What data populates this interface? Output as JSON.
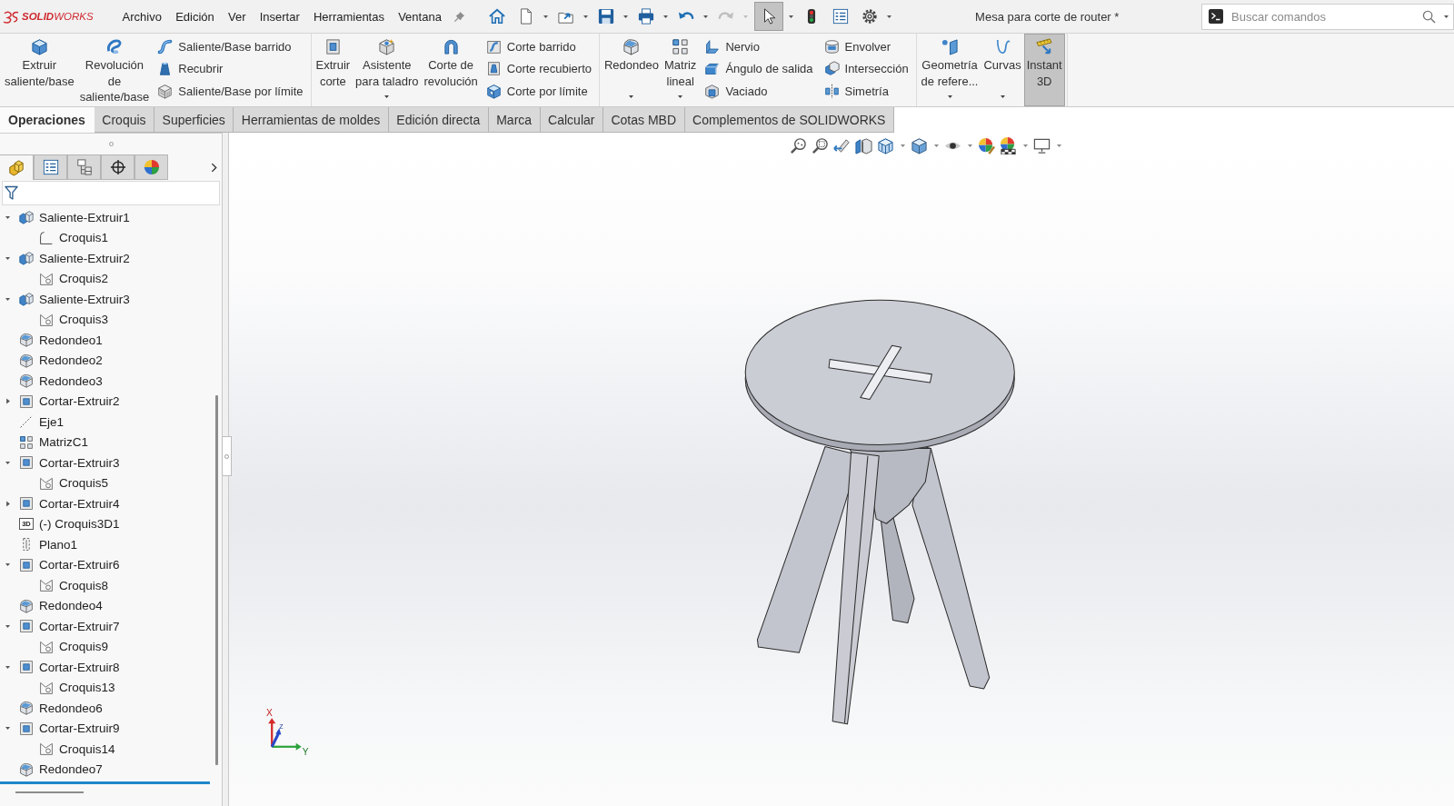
{
  "app_bar": {
    "logo": "**SOLID**WORKS",
    "menu": [
      "Archivo",
      "Edición",
      "Ver",
      "Insertar",
      "Herramientas",
      "Ventana"
    ],
    "tools": [
      {
        "kind": "home",
        "dropdown": false,
        "pressed": false,
        "disabled": false
      },
      {
        "kind": "new",
        "dropdown": true,
        "pressed": false,
        "disabled": false
      },
      {
        "kind": "open",
        "dropdown": true,
        "pressed": false,
        "disabled": false
      },
      {
        "kind": "save",
        "dropdown": true,
        "pressed": false,
        "disabled": false
      },
      {
        "kind": "print",
        "dropdown": true,
        "pressed": false,
        "disabled": false
      },
      {
        "kind": "undo",
        "dropdown": true,
        "pressed": false,
        "disabled": false
      },
      {
        "kind": "redo",
        "dropdown": true,
        "pressed": false,
        "disabled": true
      },
      {
        "kind": "select",
        "dropdown": true,
        "pressed": true,
        "disabled": false
      },
      {
        "kind": "rebuild",
        "dropdown": false,
        "pressed": false,
        "disabled": false
      },
      {
        "kind": "properties",
        "dropdown": false,
        "pressed": false,
        "disabled": false
      },
      {
        "kind": "options",
        "dropdown": true,
        "pressed": false,
        "disabled": false
      }
    ],
    "document_title": "Mesa para corte de router *",
    "search": {
      "placeholder": "Buscar comandos"
    }
  },
  "ribbon": {
    "groups": [
      {
        "buttons": [
          {
            "kind": "extrude",
            "label": "Extruir\nsaliente/base",
            "dropdown": false,
            "pressed": false
          },
          {
            "kind": "revolve",
            "label": "Revolución\nde\nsaliente/base",
            "dropdown": false,
            "pressed": false
          }
        ],
        "stacks": [
          [
            {
              "kind": "sweep",
              "label": "Saliente/Base barrido"
            },
            {
              "kind": "loft",
              "label": "Recubrir"
            },
            {
              "kind": "boundary",
              "label": "Saliente/Base por límite"
            }
          ]
        ]
      },
      {
        "buttons": [
          {
            "kind": "cutextrude",
            "label": "Extruir\ncorte",
            "dropdown": false,
            "pressed": false
          },
          {
            "kind": "hole",
            "label": "Asistente\npara taladro",
            "dropdown": true,
            "pressed": false
          },
          {
            "kind": "cutrevolve",
            "label": "Corte de\nrevolución",
            "dropdown": false,
            "pressed": false
          }
        ],
        "stacks": [
          [
            {
              "kind": "cutsweep",
              "label": "Corte barrido"
            },
            {
              "kind": "cutloft",
              "label": "Corte recubierto"
            },
            {
              "kind": "cutboundary",
              "label": "Corte por límite"
            }
          ]
        ]
      },
      {
        "buttons": [
          {
            "kind": "fillet",
            "label": "Redondeo",
            "dropdown": true,
            "pressed": false
          },
          {
            "kind": "pattern",
            "label": "Matriz\nlineal",
            "dropdown": true,
            "pressed": false
          }
        ],
        "stacks": [
          [
            {
              "kind": "rib",
              "label": "Nervio"
            },
            {
              "kind": "draft",
              "label": "Ángulo de salida"
            },
            {
              "kind": "shell",
              "label": "Vaciado"
            }
          ],
          [
            {
              "kind": "wrap",
              "label": "Envolver"
            },
            {
              "kind": "intersect",
              "label": "Intersección"
            },
            {
              "kind": "mirror",
              "label": "Simetría"
            }
          ]
        ]
      },
      {
        "buttons": [
          {
            "kind": "refgeometry",
            "label": "Geometría\nde refere...",
            "dropdown": true,
            "pressed": false
          },
          {
            "kind": "curves",
            "label": "Curvas",
            "dropdown": true,
            "pressed": false
          },
          {
            "kind": "instant3d",
            "label": "Instant\n3D",
            "dropdown": false,
            "pressed": true
          }
        ]
      }
    ]
  },
  "tabs": [
    {
      "label": "Operaciones",
      "selected": true
    },
    {
      "label": "Croquis",
      "selected": false
    },
    {
      "label": "Superficies",
      "selected": false
    },
    {
      "label": "Herramientas de moldes",
      "selected": false
    },
    {
      "label": "Edición directa",
      "selected": false
    },
    {
      "label": "Marca",
      "selected": false
    },
    {
      "label": "Calcular",
      "selected": false
    },
    {
      "label": "Cotas MBD",
      "selected": false
    },
    {
      "label": "Complementos de SOLIDWORKS",
      "selected": false
    }
  ],
  "feature_manager": {
    "panel_tabs": [
      {
        "kind": "features",
        "selected": true
      },
      {
        "kind": "properties",
        "selected": false
      },
      {
        "kind": "configurations",
        "selected": false
      },
      {
        "kind": "dimxpert",
        "selected": false
      },
      {
        "kind": "display",
        "selected": false
      }
    ],
    "tree": [
      {
        "label": "Saliente-Extruir1",
        "kind": "boss",
        "expanded": true,
        "children": [
          {
            "label": "Croquis1",
            "kind": "sketchline"
          }
        ]
      },
      {
        "label": "Saliente-Extruir2",
        "kind": "boss",
        "expanded": true,
        "children": [
          {
            "label": "Croquis2",
            "kind": "sketch"
          }
        ]
      },
      {
        "label": "Saliente-Extruir3",
        "kind": "boss",
        "expanded": true,
        "children": [
          {
            "label": "Croquis3",
            "kind": "sketch"
          }
        ]
      },
      {
        "label": "Redondeo1",
        "kind": "fillet"
      },
      {
        "label": "Redondeo2",
        "kind": "fillet"
      },
      {
        "label": "Redondeo3",
        "kind": "fillet"
      },
      {
        "label": "Cortar-Extruir2",
        "kind": "cut",
        "expanded": false
      },
      {
        "label": "Eje1",
        "kind": "axis"
      },
      {
        "label": "MatrizC1",
        "kind": "pattern"
      },
      {
        "label": "Cortar-Extruir3",
        "kind": "cut",
        "expanded": true,
        "children": [
          {
            "label": "Croquis5",
            "kind": "sketch"
          }
        ]
      },
      {
        "label": "Cortar-Extruir4",
        "kind": "cut",
        "expanded": false
      },
      {
        "label": "(-) Croquis3D1",
        "kind": "sketch3d",
        "tag": "3D"
      },
      {
        "label": "Plano1",
        "kind": "plane"
      },
      {
        "label": "Cortar-Extruir6",
        "kind": "cut",
        "expanded": true,
        "children": [
          {
            "label": "Croquis8",
            "kind": "sketch"
          }
        ]
      },
      {
        "label": "Redondeo4",
        "kind": "fillet"
      },
      {
        "label": "Cortar-Extruir7",
        "kind": "cut",
        "expanded": true,
        "children": [
          {
            "label": "Croquis9",
            "kind": "sketch"
          }
        ]
      },
      {
        "label": "Cortar-Extruir8",
        "kind": "cut",
        "expanded": true,
        "children": [
          {
            "label": "Croquis13",
            "kind": "sketch"
          }
        ]
      },
      {
        "label": "Redondeo6",
        "kind": "fillet"
      },
      {
        "label": "Cortar-Extruir9",
        "kind": "cut",
        "expanded": true,
        "children": [
          {
            "label": "Croquis14",
            "kind": "sketch"
          }
        ]
      },
      {
        "label": "Redondeo7",
        "kind": "fillet"
      }
    ]
  },
  "viewport": {
    "triad": {
      "x": "X",
      "y": "Y",
      "z": "Z"
    }
  }
}
